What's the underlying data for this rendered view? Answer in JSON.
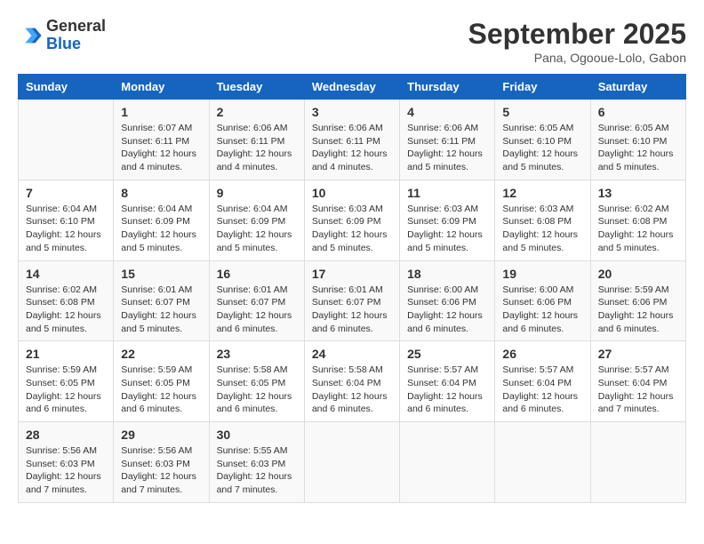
{
  "header": {
    "logo_line1": "General",
    "logo_line2": "Blue",
    "month": "September 2025",
    "location": "Pana, Ogooue-Lolo, Gabon"
  },
  "days_of_week": [
    "Sunday",
    "Monday",
    "Tuesday",
    "Wednesday",
    "Thursday",
    "Friday",
    "Saturday"
  ],
  "weeks": [
    [
      {
        "day": "",
        "info": ""
      },
      {
        "day": "1",
        "info": "Sunrise: 6:07 AM\nSunset: 6:11 PM\nDaylight: 12 hours\nand 4 minutes."
      },
      {
        "day": "2",
        "info": "Sunrise: 6:06 AM\nSunset: 6:11 PM\nDaylight: 12 hours\nand 4 minutes."
      },
      {
        "day": "3",
        "info": "Sunrise: 6:06 AM\nSunset: 6:11 PM\nDaylight: 12 hours\nand 4 minutes."
      },
      {
        "day": "4",
        "info": "Sunrise: 6:06 AM\nSunset: 6:11 PM\nDaylight: 12 hours\nand 5 minutes."
      },
      {
        "day": "5",
        "info": "Sunrise: 6:05 AM\nSunset: 6:10 PM\nDaylight: 12 hours\nand 5 minutes."
      },
      {
        "day": "6",
        "info": "Sunrise: 6:05 AM\nSunset: 6:10 PM\nDaylight: 12 hours\nand 5 minutes."
      }
    ],
    [
      {
        "day": "7",
        "info": "Sunrise: 6:04 AM\nSunset: 6:10 PM\nDaylight: 12 hours\nand 5 minutes."
      },
      {
        "day": "8",
        "info": "Sunrise: 6:04 AM\nSunset: 6:09 PM\nDaylight: 12 hours\nand 5 minutes."
      },
      {
        "day": "9",
        "info": "Sunrise: 6:04 AM\nSunset: 6:09 PM\nDaylight: 12 hours\nand 5 minutes."
      },
      {
        "day": "10",
        "info": "Sunrise: 6:03 AM\nSunset: 6:09 PM\nDaylight: 12 hours\nand 5 minutes."
      },
      {
        "day": "11",
        "info": "Sunrise: 6:03 AM\nSunset: 6:09 PM\nDaylight: 12 hours\nand 5 minutes."
      },
      {
        "day": "12",
        "info": "Sunrise: 6:03 AM\nSunset: 6:08 PM\nDaylight: 12 hours\nand 5 minutes."
      },
      {
        "day": "13",
        "info": "Sunrise: 6:02 AM\nSunset: 6:08 PM\nDaylight: 12 hours\nand 5 minutes."
      }
    ],
    [
      {
        "day": "14",
        "info": "Sunrise: 6:02 AM\nSunset: 6:08 PM\nDaylight: 12 hours\nand 5 minutes."
      },
      {
        "day": "15",
        "info": "Sunrise: 6:01 AM\nSunset: 6:07 PM\nDaylight: 12 hours\nand 5 minutes."
      },
      {
        "day": "16",
        "info": "Sunrise: 6:01 AM\nSunset: 6:07 PM\nDaylight: 12 hours\nand 6 minutes."
      },
      {
        "day": "17",
        "info": "Sunrise: 6:01 AM\nSunset: 6:07 PM\nDaylight: 12 hours\nand 6 minutes."
      },
      {
        "day": "18",
        "info": "Sunrise: 6:00 AM\nSunset: 6:06 PM\nDaylight: 12 hours\nand 6 minutes."
      },
      {
        "day": "19",
        "info": "Sunrise: 6:00 AM\nSunset: 6:06 PM\nDaylight: 12 hours\nand 6 minutes."
      },
      {
        "day": "20",
        "info": "Sunrise: 5:59 AM\nSunset: 6:06 PM\nDaylight: 12 hours\nand 6 minutes."
      }
    ],
    [
      {
        "day": "21",
        "info": "Sunrise: 5:59 AM\nSunset: 6:05 PM\nDaylight: 12 hours\nand 6 minutes."
      },
      {
        "day": "22",
        "info": "Sunrise: 5:59 AM\nSunset: 6:05 PM\nDaylight: 12 hours\nand 6 minutes."
      },
      {
        "day": "23",
        "info": "Sunrise: 5:58 AM\nSunset: 6:05 PM\nDaylight: 12 hours\nand 6 minutes."
      },
      {
        "day": "24",
        "info": "Sunrise: 5:58 AM\nSunset: 6:04 PM\nDaylight: 12 hours\nand 6 minutes."
      },
      {
        "day": "25",
        "info": "Sunrise: 5:57 AM\nSunset: 6:04 PM\nDaylight: 12 hours\nand 6 minutes."
      },
      {
        "day": "26",
        "info": "Sunrise: 5:57 AM\nSunset: 6:04 PM\nDaylight: 12 hours\nand 6 minutes."
      },
      {
        "day": "27",
        "info": "Sunrise: 5:57 AM\nSunset: 6:04 PM\nDaylight: 12 hours\nand 7 minutes."
      }
    ],
    [
      {
        "day": "28",
        "info": "Sunrise: 5:56 AM\nSunset: 6:03 PM\nDaylight: 12 hours\nand 7 minutes."
      },
      {
        "day": "29",
        "info": "Sunrise: 5:56 AM\nSunset: 6:03 PM\nDaylight: 12 hours\nand 7 minutes."
      },
      {
        "day": "30",
        "info": "Sunrise: 5:55 AM\nSunset: 6:03 PM\nDaylight: 12 hours\nand 7 minutes."
      },
      {
        "day": "",
        "info": ""
      },
      {
        "day": "",
        "info": ""
      },
      {
        "day": "",
        "info": ""
      },
      {
        "day": "",
        "info": ""
      }
    ]
  ]
}
